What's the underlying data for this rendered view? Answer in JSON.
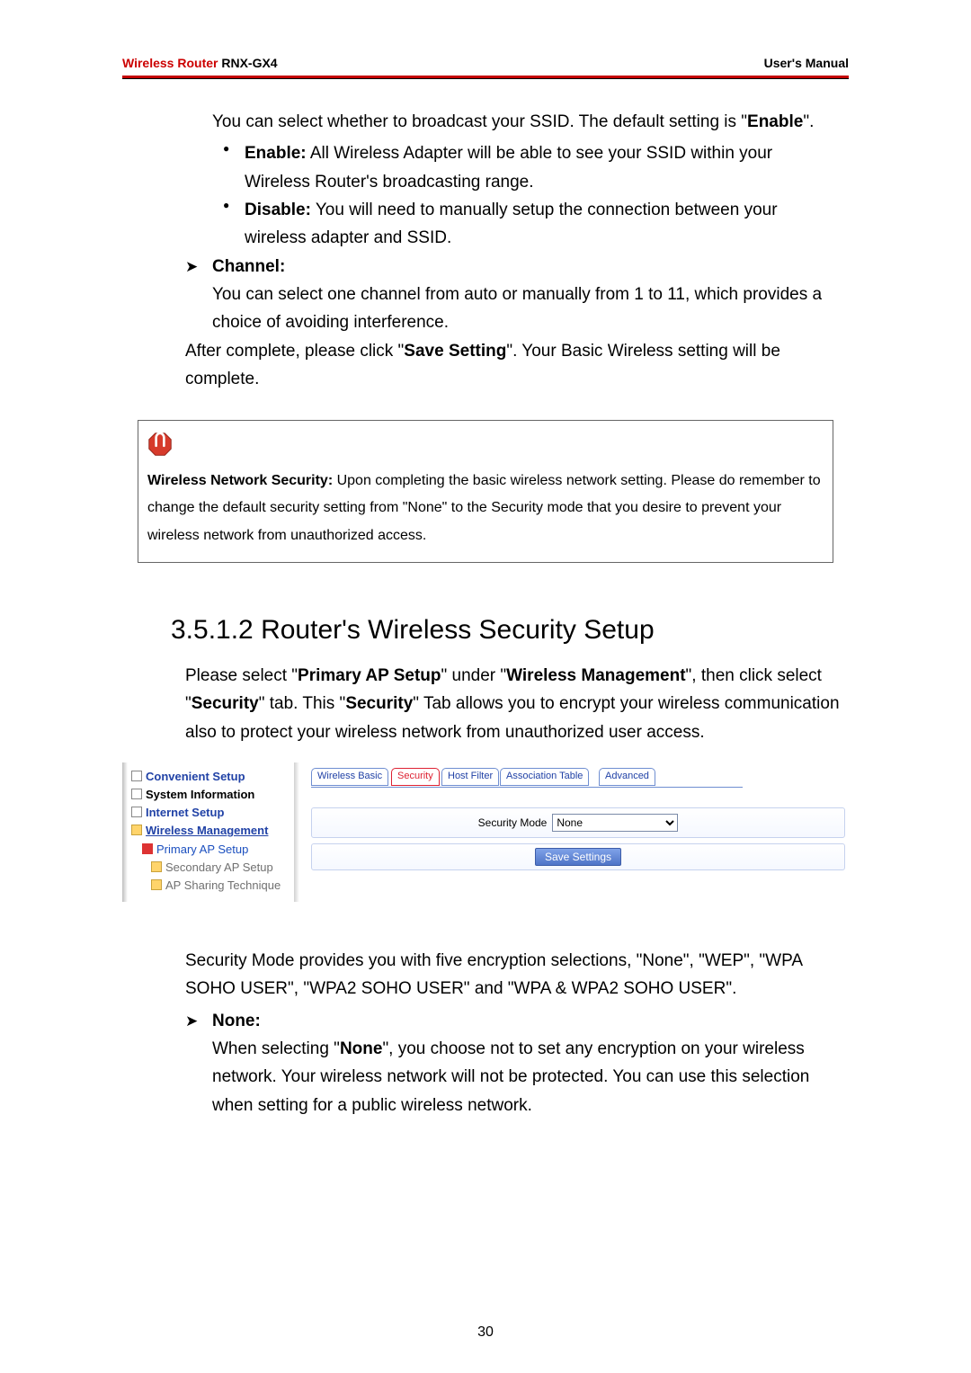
{
  "header": {
    "product": "Wireless Router",
    "model": " RNX-GX4",
    "right": "User's Manual"
  },
  "ssid_intro_a": "You can select whether to broadcast your SSID. The default setting is \"",
  "ssid_intro_bold": "Enable",
  "ssid_intro_b": "\".",
  "enable_label": "Enable:",
  "enable_text": " All Wireless Adapter will be able to see your SSID within your Wireless Router's broadcasting range.",
  "disable_label": "Disable:",
  "disable_text": " You will need to manually setup the connection between your wireless adapter and SSID.",
  "channel_label": "Channel:",
  "channel_text": "You can select one channel from auto or manually from 1 to 11, which provides a choice of avoiding interference.",
  "after_a": "After complete, please click \"",
  "after_bold": "Save Setting",
  "after_b": "\". Your Basic Wireless setting will be complete.",
  "note_bold": "Wireless Network Security:",
  "note_text": " Upon completing the basic wireless network setting. Please do remember to change the default security setting from \"None\" to the Security mode that you desire to prevent your wireless network from unauthorized access.",
  "section_title": "3.5.1.2 Router's Wireless Security Setup",
  "p2_a": "Please select \"",
  "p2_b1": "Primary AP Setup",
  "p2_b": "\" under \"",
  "p2_b2": "Wireless Management",
  "p2_c": "\", then click select \"",
  "p2_b3": "Security",
  "p2_d": "\" tab. This \"",
  "p2_b4": "Security",
  "p2_e": "\" Tab allows you to encrypt your wireless communication also to protect your wireless network from unauthorized user access.",
  "nav": {
    "conv": "Convenient Setup",
    "sys": "System Information",
    "inet": "Internet Setup",
    "wmgmt": "Wireless Management",
    "pri": "Primary AP Setup",
    "sec": "Secondary AP Setup",
    "apshare": "AP Sharing Technique"
  },
  "tabs": {
    "t1": "Wireless Basic",
    "t2": "Security",
    "t3": "Host Filter",
    "t4": "Association Table",
    "t5": "Advanced"
  },
  "form": {
    "mode_label": "Security Mode",
    "mode_value": "None",
    "save": "Save Settings"
  },
  "p3": "Security Mode provides you with five encryption selections, \"None\", \"WEP\", \"WPA SOHO USER\", \"WPA2 SOHO USER\" and \"WPA & WPA2 SOHO USER\".",
  "none_label": "None:",
  "none_a": "When selecting \"",
  "none_bold": "None",
  "none_b": "\", you choose not to set any encryption on your wireless network. Your wireless network will not be protected. You can use this selection when setting for a public wireless network.",
  "page_number": "30"
}
